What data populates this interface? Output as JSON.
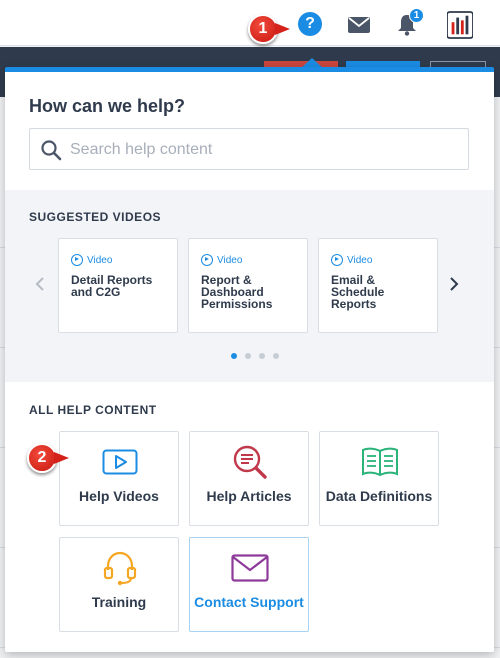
{
  "topbar": {
    "help_icon": "question-circle-icon",
    "help_glyph": "?",
    "mail_icon": "envelope-icon",
    "bell_icon": "bell-icon",
    "notification_count": "1",
    "brand_icon": "bar-chart-logo-icon"
  },
  "callouts": {
    "first": "1",
    "second": "2"
  },
  "panel": {
    "title": "How can we help?",
    "search_placeholder": "Search help content",
    "suggested_label": "SUGGESTED VIDEOS",
    "videos": [
      {
        "tag": "Video",
        "title": "Detail Reports and C2G"
      },
      {
        "tag": "Video",
        "title": "Report & Dashboard Permissions"
      },
      {
        "tag": "Video",
        "title": "Email & Schedule Reports"
      }
    ],
    "carousel": {
      "pages": 4,
      "current": 1
    },
    "all_label": "ALL HELP CONTENT",
    "tiles": [
      {
        "label": "Help Videos",
        "icon": "video-play-icon"
      },
      {
        "label": "Help Articles",
        "icon": "search-document-icon"
      },
      {
        "label": "Data Definitions",
        "icon": "open-book-icon"
      },
      {
        "label": "Training",
        "icon": "headset-icon"
      },
      {
        "label": "Contact Support",
        "icon": "envelope-icon"
      }
    ]
  },
  "colors": {
    "accent": "#1b8ce3",
    "callout": "#d4221a",
    "articles_icon": "#c0394b",
    "definitions_icon": "#2bb37a",
    "training_icon": "#f5a623",
    "support_icon": "#8e3a9b"
  }
}
